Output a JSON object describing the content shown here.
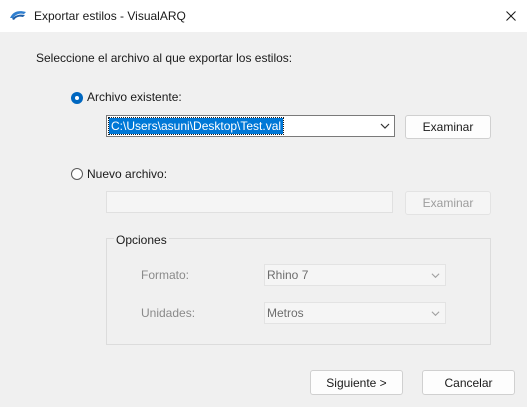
{
  "window": {
    "title": "Exportar estilos - VisualARQ",
    "close_label": "Cerrar"
  },
  "prompt": "Seleccione el archivo al que exportar los estilos:",
  "existing": {
    "radio_label": "Archivo existente:",
    "selected": true,
    "path": "C:\\Users\\asuni\\Desktop\\Test.val",
    "browse_label": "Examinar"
  },
  "new_file": {
    "radio_label": "Nuevo archivo:",
    "selected": false,
    "path": "",
    "browse_label": "Examinar"
  },
  "options": {
    "title": "Opciones",
    "format_label": "Formato:",
    "format_value": "Rhino 7",
    "units_label": "Unidades:",
    "units_value": "Metros"
  },
  "footer": {
    "next_label": "Siguiente >",
    "cancel_label": "Cancelar"
  },
  "colors": {
    "accent": "#0067c0",
    "selection": "#0078d7",
    "background": "#f0f0f0"
  }
}
